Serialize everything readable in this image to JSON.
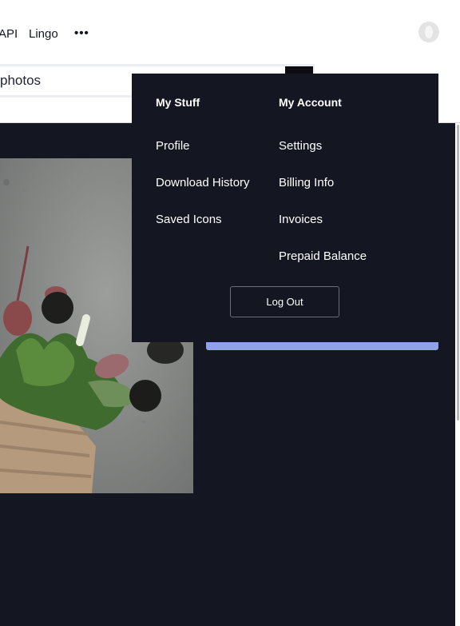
{
  "nav": {
    "links": [
      {
        "label": "API"
      },
      {
        "label": "Lingo"
      }
    ],
    "more_icon": "more-horizontal-icon",
    "avatar_icon": "user-avatar-icon"
  },
  "search": {
    "value": "photos",
    "button_icon": "search-icon"
  },
  "photo": {
    "subject": "produce-basket-photo"
  },
  "dropdown": {
    "my_stuff": {
      "heading": "My Stuff",
      "items": [
        "Profile",
        "Download History",
        "Saved Icons"
      ]
    },
    "my_account": {
      "heading": "My Account",
      "items": [
        "Settings",
        "Billing Info",
        "Invoices",
        "Prepaid Balance"
      ]
    },
    "logout_label": "Log Out"
  },
  "colors": {
    "dark_bg": "#141722",
    "accent": "#8fa1e8"
  }
}
